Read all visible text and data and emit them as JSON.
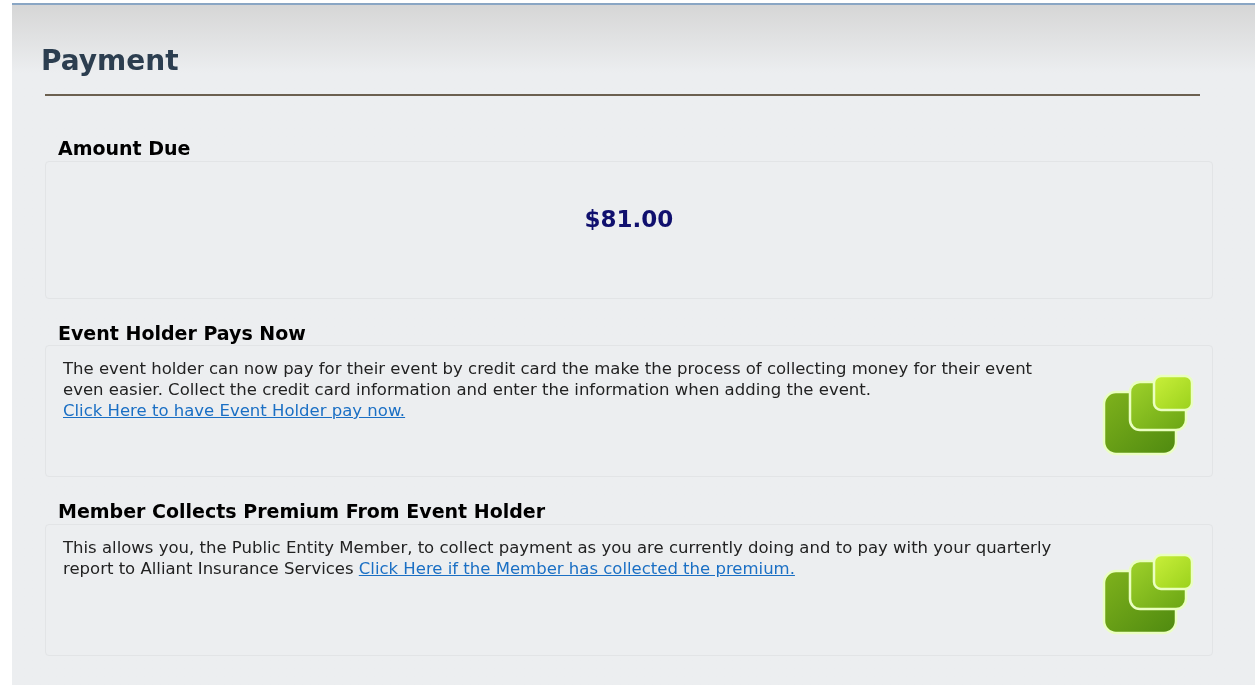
{
  "title": "Payment",
  "sections": [
    {
      "kind": "amount",
      "title": "Amount Due",
      "amount": "$81.00"
    },
    {
      "kind": "option",
      "title": "Event Holder Pays Now",
      "text": "The event holder can now pay for their event by credit card the make the process of collecting money for their event even easier. Collect the credit card information and enter the information when adding the event.",
      "link": "Click Here to have Event Holder pay now."
    },
    {
      "kind": "option",
      "title": "Member Collects Premium From Event Holder",
      "text": "This allows you, the Public Entity Member, to collect payment as you are currently doing and to pay with your quarterly report to Alliant Insurance Services",
      "link": "Click Here if the Member has collected the premium."
    }
  ]
}
